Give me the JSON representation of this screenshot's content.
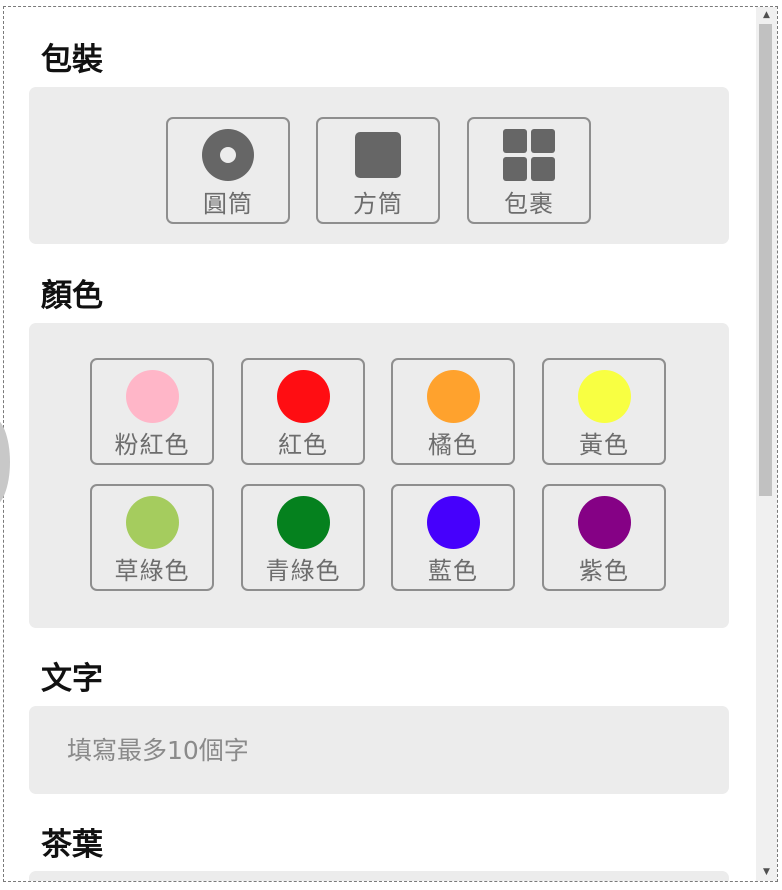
{
  "packaging": {
    "title": "包裝",
    "options": [
      {
        "label": "圓筒",
        "icon": "cylinder-icon"
      },
      {
        "label": "方筒",
        "icon": "square-box-icon"
      },
      {
        "label": "包裹",
        "icon": "grid-package-icon"
      }
    ]
  },
  "color": {
    "title": "顏色",
    "options": [
      {
        "label": "粉紅色",
        "hex": "#FFB6C8"
      },
      {
        "label": "紅色",
        "hex": "#FF0D12"
      },
      {
        "label": "橘色",
        "hex": "#FFA22D"
      },
      {
        "label": "黃色",
        "hex": "#F8FF42"
      },
      {
        "label": "草綠色",
        "hex": "#A5CC5E"
      },
      {
        "label": "青綠色",
        "hex": "#05811E"
      },
      {
        "label": "藍色",
        "hex": "#4600FC"
      },
      {
        "label": "紫色",
        "hex": "#850185"
      }
    ]
  },
  "text": {
    "title": "文字",
    "placeholder": "填寫最多10個字",
    "value": ""
  },
  "tea": {
    "title": "茶葉"
  }
}
